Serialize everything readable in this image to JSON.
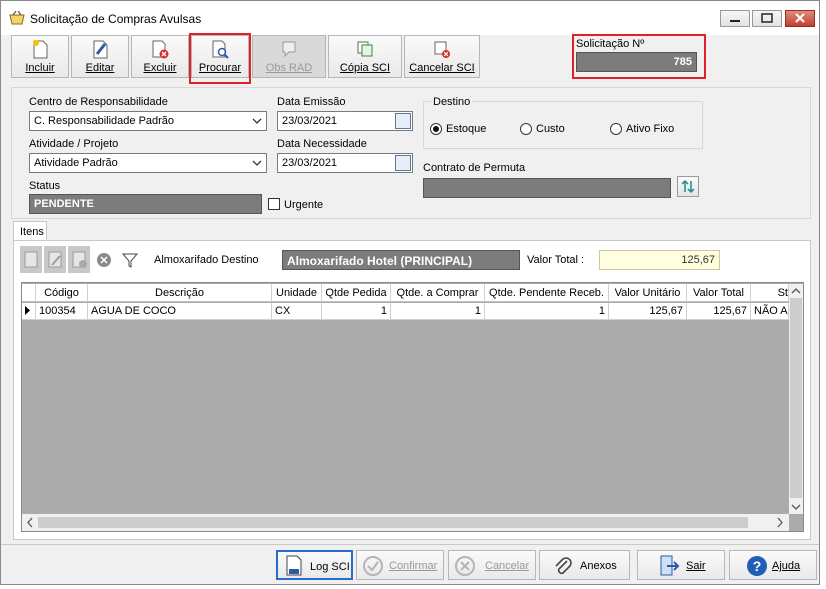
{
  "window": {
    "title": "Solicitação de Compras Avulsas"
  },
  "toolbar": {
    "incluir": "Incluir",
    "editar": "Editar",
    "excluir": "Excluir",
    "procurar": "Procurar",
    "obs_rad": "Obs RAD",
    "copia_sci": "Cópia SCI",
    "cancelar_sci": "Cancelar SCI"
  },
  "solicitacao": {
    "label": "Solicitação Nº",
    "value": "785"
  },
  "form": {
    "centro_label": "Centro de Responsabilidade",
    "centro_value": "C. Responsabilidade Padrão",
    "atividade_label": "Atividade / Projeto",
    "atividade_value": "Atividade Padrão",
    "status_label": "Status",
    "status_value": "PENDENTE",
    "data_emissao_label": "Data Emissão",
    "data_emissao_value": "23/03/2021",
    "data_necessidade_label": "Data Necessidade",
    "data_necessidade_value": "23/03/2021",
    "urgente_label": "Urgente",
    "destino_label": "Destino",
    "destino_options": [
      "Estoque",
      "Custo",
      "Ativo Fixo"
    ],
    "contrato_label": "Contrato de Permuta",
    "contrato_value": ""
  },
  "itens": {
    "tab_label": "Itens",
    "almox_label": "Almoxarifado Destino",
    "almox_value": "Almoxarifado Hotel (PRINCIPAL)",
    "valor_total_label": "Valor Total :",
    "valor_total_value": "125,67",
    "columns": [
      "Código",
      "Descrição",
      "Unidade",
      "Qtde Pedida",
      "Qtde. a Comprar",
      "Qtde. Pendente Receb.",
      "Valor Unitário",
      "Valor Total",
      "St"
    ],
    "rows": [
      [
        "100354",
        "AGUA DE COCO",
        "CX",
        "1",
        "1",
        "1",
        "125,67",
        "125,67",
        "NÃO A"
      ]
    ]
  },
  "footer": {
    "log_sci": "Log SCI",
    "confirmar": "Confirmar",
    "cancelar": "Cancelar",
    "anexos": "Anexos",
    "sair": "Sair",
    "ajuda": "Ajuda"
  },
  "colors": {
    "highlight": "#e0202b",
    "dark_field": "#7c7c7c",
    "total_bg": "#ffffe0"
  }
}
